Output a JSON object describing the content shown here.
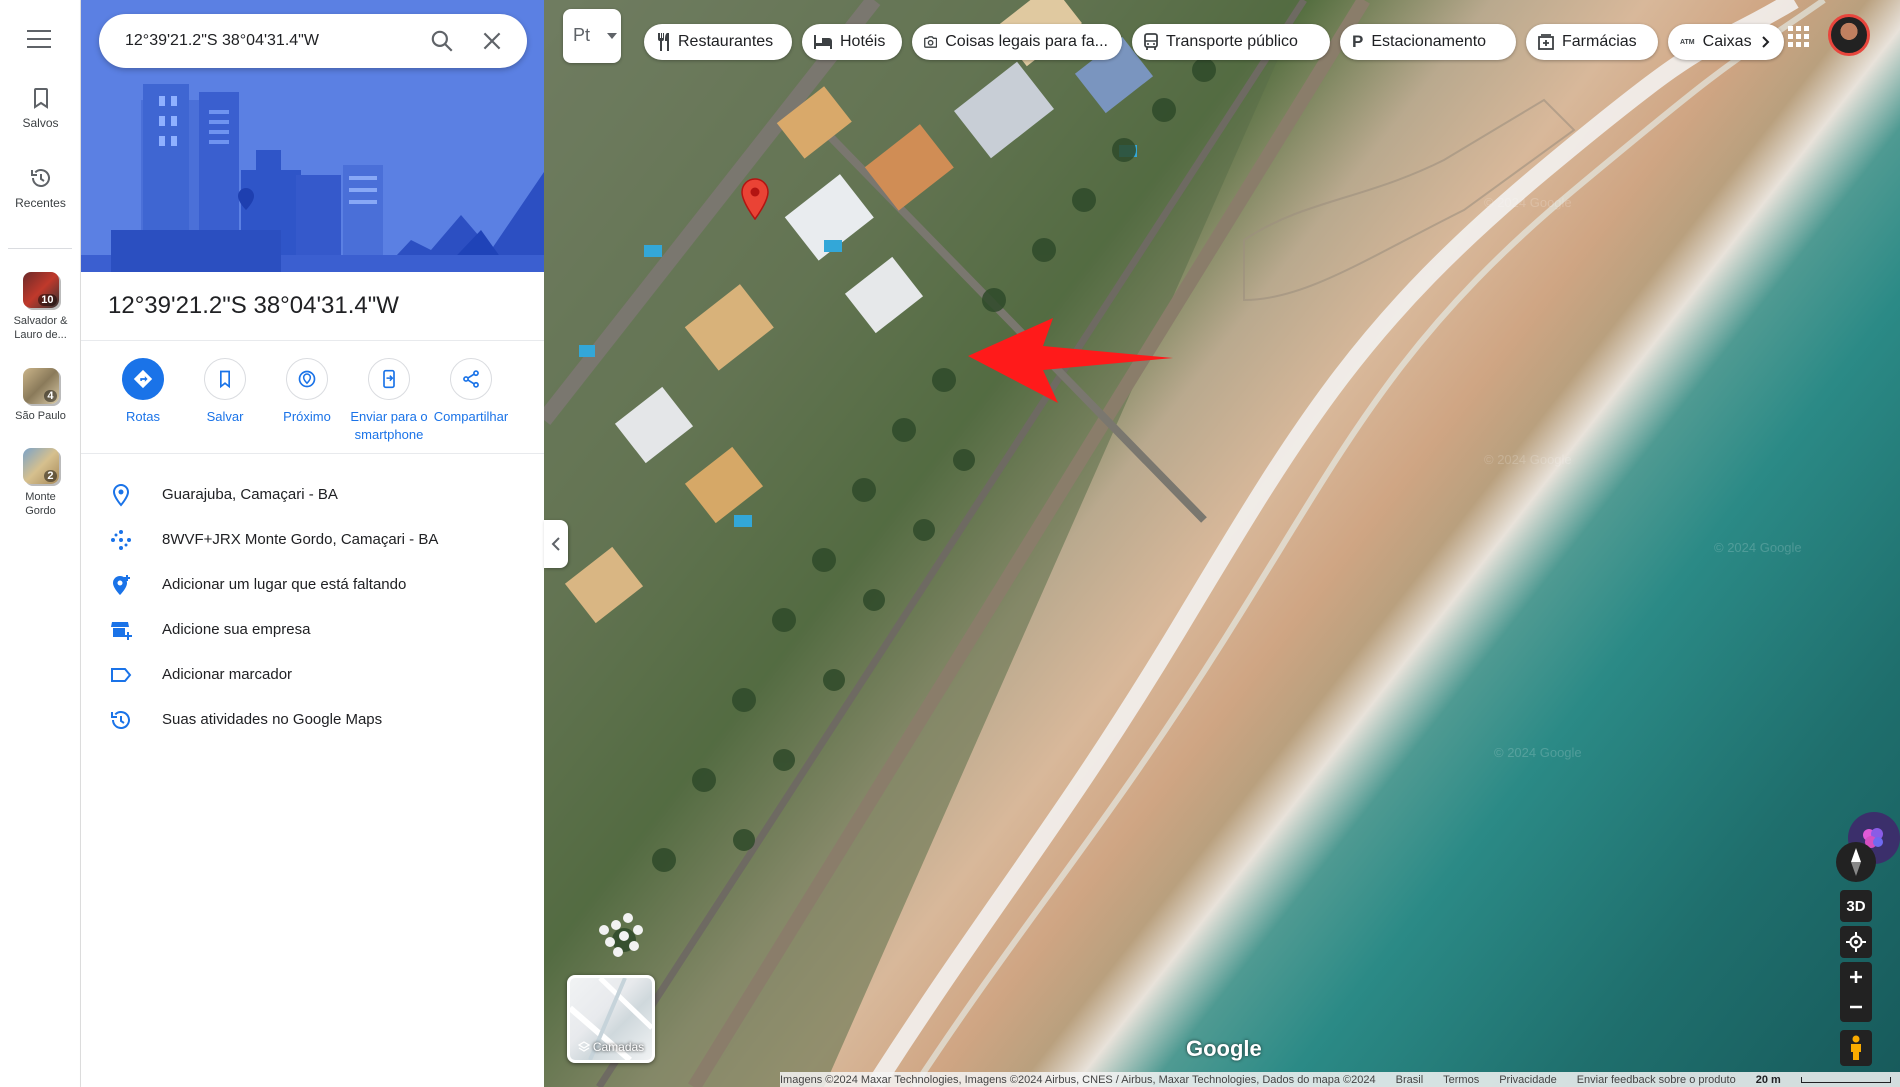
{
  "rail": {
    "saved_label": "Salvos",
    "recent_label": "Recentes",
    "places": [
      {
        "label": "Salvador & Lauro de...",
        "count": "10"
      },
      {
        "label": "São Paulo",
        "count": "4"
      },
      {
        "label": "Monte Gordo",
        "count": "2"
      }
    ]
  },
  "search": {
    "value": "12°39'21.2\"S 38°04'31.4\"W"
  },
  "place": {
    "title": "12°39'21.2\"S 38°04'31.4\"W"
  },
  "actions": [
    {
      "label": "Rotas"
    },
    {
      "label": "Salvar"
    },
    {
      "label": "Próximo"
    },
    {
      "label": "Enviar para o smartphone"
    },
    {
      "label": "Compartilhar"
    }
  ],
  "info": [
    {
      "text": "Guarajuba, Camaçari - BA",
      "icon": "pin-icon"
    },
    {
      "text": "8WVF+JRX Monte Gordo, Camaçari - BA",
      "icon": "plus-code-icon"
    },
    {
      "text": "Adicionar um lugar que está faltando",
      "icon": "add-place-icon"
    },
    {
      "text": "Adicione sua empresa",
      "icon": "add-business-icon"
    },
    {
      "text": "Adicionar marcador",
      "icon": "label-icon"
    },
    {
      "text": "Suas atividades no Google Maps",
      "icon": "history-icon"
    }
  ],
  "map": {
    "lang_label": "Pt",
    "chips": [
      {
        "label": "Restaurantes",
        "icon": "fork-knife-icon"
      },
      {
        "label": "Hotéis",
        "icon": "bed-icon"
      },
      {
        "label": "Coisas legais para fa...",
        "icon": "camera-icon"
      },
      {
        "label": "Transporte público",
        "icon": "bus-icon"
      },
      {
        "label": "Estacionamento",
        "icon": "parking-icon"
      },
      {
        "label": "Farmácias",
        "icon": "pharmacy-icon"
      },
      {
        "label": "Caixas",
        "icon": "atm-icon"
      }
    ],
    "atm_badge": "ATM",
    "layers_label": "Camadas",
    "three_d_label": "3D",
    "google_logo": "Google",
    "watermark": "© 2024 Google",
    "footer": {
      "imagery": "Imagens ©2024 Maxar Technologies, Imagens ©2024 Airbus, CNES / Airbus, Maxar Technologies, Dados do mapa ©2024",
      "country": "Brasil",
      "terms": "Termos",
      "privacy": "Privacidade",
      "feedback": "Enviar feedback sobre o produto",
      "scale": "20 m"
    }
  },
  "colors": {
    "accent": "#1a73e8",
    "pin": "#ea4335",
    "arrow": "#ff1a1a"
  }
}
